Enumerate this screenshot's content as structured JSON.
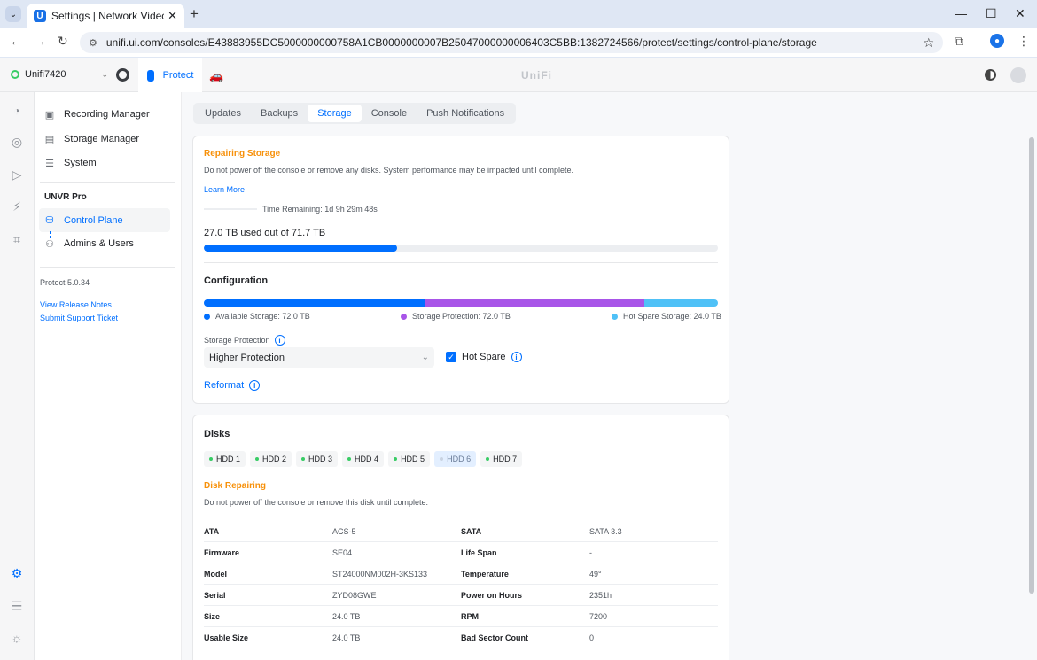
{
  "browser": {
    "tab_title": "Settings | Network Video Recor",
    "url": "unifi.ui.com/consoles/E43883955DC5000000000758A1CB0000000007B25047000000006403C5BB:1382724566/protect/settings/control-plane/storage"
  },
  "header": {
    "console_name": "Unifi7420",
    "app_name": "Protect",
    "logo_text": "UniFi"
  },
  "sidebar": {
    "items": [
      {
        "label": "Recording Manager"
      },
      {
        "label": "Storage Manager"
      },
      {
        "label": "System"
      }
    ],
    "group_title": "UNVR Pro",
    "group_items": [
      {
        "label": "Control Plane"
      },
      {
        "label": "Admins & Users"
      }
    ],
    "version": "Protect 5.0.34",
    "links": [
      "View Release Notes",
      "Submit Support Ticket"
    ]
  },
  "subtabs": [
    "Updates",
    "Backups",
    "Storage",
    "Console",
    "Push Notifications"
  ],
  "repair": {
    "title": "Repairing Storage",
    "message": "Do not power off the console or remove any disks. System performance may be impacted until complete.",
    "learn_more": "Learn More",
    "time_remaining": "Time Remaining: 1d 9h 29m 48s",
    "usage_text": "27.0 TB used out of 71.7 TB",
    "used_tb": 27.0,
    "total_tb": 71.7
  },
  "configuration": {
    "title": "Configuration",
    "segments": [
      {
        "label": "Available Storage: 72.0 TB",
        "value": 72.0,
        "color": "#006fff"
      },
      {
        "label": "Storage Protection: 72.0 TB",
        "value": 72.0,
        "color": "#a855e8"
      },
      {
        "label": "Hot Spare Storage: 24.0 TB",
        "value": 24.0,
        "color": "#4fc1f7"
      }
    ],
    "protection_label": "Storage Protection",
    "protection_value": "Higher Protection",
    "hot_spare_label": "Hot Spare",
    "reformat_label": "Reformat"
  },
  "disks": {
    "title": "Disks",
    "chips": [
      "HDD 1",
      "HDD 2",
      "HDD 3",
      "HDD 4",
      "HDD 5",
      "HDD 6",
      "HDD 7"
    ],
    "selected": "HDD 6",
    "repair_title": "Disk Repairing",
    "repair_message": "Do not power off the console or remove this disk until complete.",
    "rows": [
      {
        "k1": "ATA",
        "v1": "ACS-5",
        "k2": "SATA",
        "v2": "SATA 3.3"
      },
      {
        "k1": "Firmware",
        "v1": "SE04",
        "k2": "Life Span",
        "v2": "-"
      },
      {
        "k1": "Model",
        "v1": "ST24000NM002H-3KS133",
        "k2": "Temperature",
        "v2": "49°"
      },
      {
        "k1": "Serial",
        "v1": "ZYD08GWE",
        "k2": "Power on Hours",
        "v2": "2351h"
      },
      {
        "k1": "Size",
        "v1": "24.0 TB",
        "k2": "RPM",
        "v2": "7200"
      },
      {
        "k1": "Usable Size",
        "v1": "24.0 TB",
        "k2": "Bad Sector Count",
        "v2": "0"
      }
    ]
  }
}
